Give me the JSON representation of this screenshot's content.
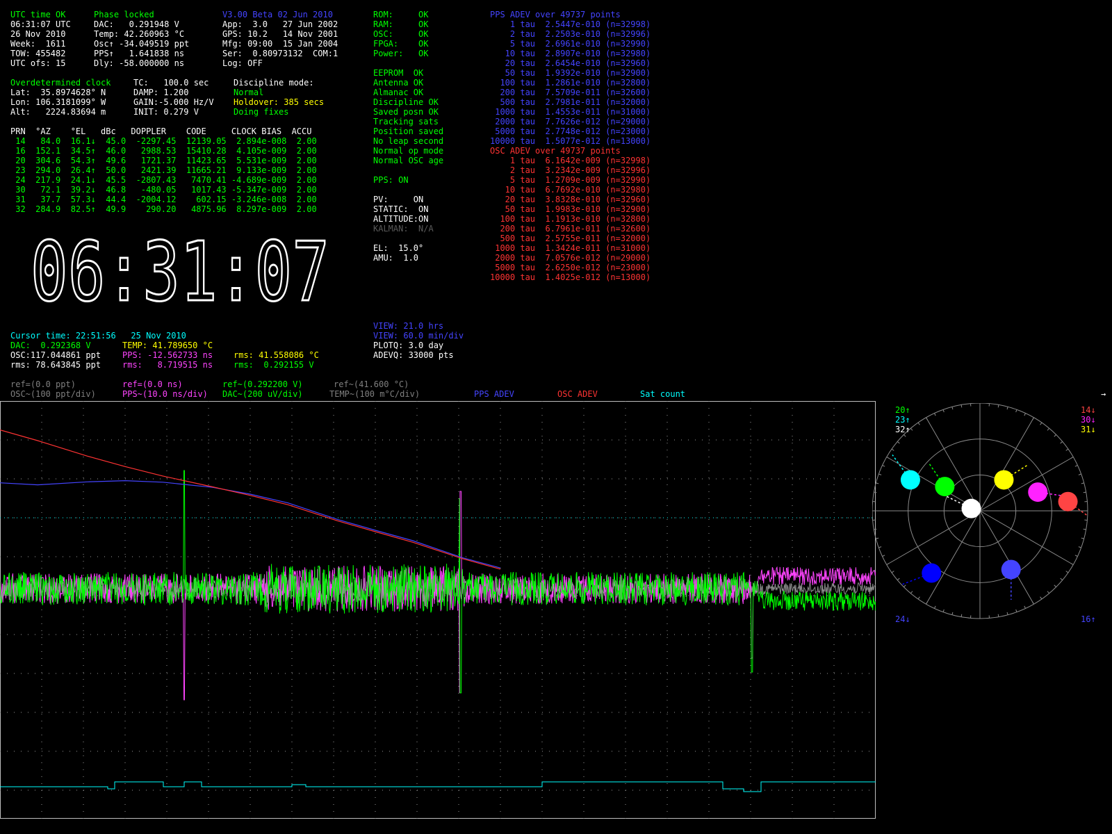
{
  "status_block": {
    "lines": [
      "UTC time OK",
      "06:31:07 UTC",
      "26 Nov 2010",
      "Week:  1611",
      "TOW: 455482",
      "UTC ofs: 15"
    ]
  },
  "phase_block": {
    "lines": [
      "Phase locked",
      "DAC:   0.291948 V",
      "Temp: 42.260963 °C",
      "Osc↑ -34.049519 ppt",
      "PPS↑   1.641838 ns",
      "Dly: -58.000000 ns"
    ]
  },
  "version_block": {
    "lines": [
      "V3.00 Beta 02 Jun 2010",
      "App:  3.0   27 Jun 2002",
      "GPS: 10.2   14 Nov 2001",
      "Mfg: 09:00  15 Jan 2004",
      "Ser:  0.80973132  COM:1",
      "Log: OFF"
    ]
  },
  "selftest_block": {
    "lines": [
      "ROM:     OK",
      "RAM:     OK",
      "OSC:     OK",
      "FPGA:    OK",
      "Power:   OK"
    ]
  },
  "position_block": {
    "lines": [
      "Overdetermined clock",
      "Lat:  35.8974628° N",
      "Lon: 106.3181099° W",
      "Alt:   2224.83694 m"
    ]
  },
  "discipline_params": {
    "lines": [
      "TC:   100.0 sec",
      "DAMP: 1.200",
      "GAIN:-5.000 Hz/V",
      "INIT: 0.279 V"
    ]
  },
  "discipline_mode": {
    "title": "Discipline mode:",
    "mode": "Normal",
    "holdover_label": "Holdover:",
    "holdover_value": " 385 secs",
    "fixes": "Doing fixes"
  },
  "receiver_status": {
    "lines": [
      "EEPROM  OK",
      "Antenna OK",
      "Almanac OK",
      "Discipline OK",
      "Saved posn OK",
      "Tracking sats",
      "Position saved",
      "No leap second",
      "Normal op mode",
      "Normal OSC age"
    ]
  },
  "pps_state": "PPS: ON",
  "filters": {
    "lines": [
      "PV:     ON",
      "STATIC:  ON",
      "ALTITUDE:ON"
    ],
    "kalman": "KALMAN:  N/A"
  },
  "mask": {
    "lines": [
      "EL:  15.0°",
      "AMU:  1.0"
    ]
  },
  "sat_table": {
    "header": "PRN  °AZ    °EL   dBc   DOPPLER    CODE     CLOCK BIAS  ACCU",
    "rows": [
      " 14   84.0  16.1↓  45.0  -2297.45  12139.05  2.894e-008  2.00",
      " 16  152.1  34.5↑  46.0   2988.53  15410.28  4.105e-009  2.00",
      " 20  304.6  54.3↑  49.6   1721.37  11423.65  5.531e-009  2.00",
      " 23  294.0  26.4↑  50.0   2421.39  11665.21  9.133e-009  2.00",
      " 24  217.9  24.1↓  45.5  -2807.43   7470.41 -4.689e-009  2.00",
      " 30   72.1  39.2↓  46.8   -480.05   1017.43 -5.347e-009  2.00",
      " 31   37.7  57.3↓  44.4  -2004.12    602.15 -3.246e-008  2.00",
      " 32  284.9  82.5↑  49.9    290.20   4875.96  8.297e-009  2.00"
    ]
  },
  "big_clock": "06:31:07",
  "pps_adev": {
    "title": "PPS ADEV over 49737 points",
    "rows": [
      "    1 tau  2.5447e-010 (n=32998)",
      "    2 tau  2.2503e-010 (n=32996)",
      "    5 tau  2.6961e-010 (n=32990)",
      "   10 tau  2.8907e-010 (n=32980)",
      "   20 tau  2.6454e-010 (n=32960)",
      "   50 tau  1.9392e-010 (n=32900)",
      "  100 tau  1.2861e-010 (n=32800)",
      "  200 tau  7.5709e-011 (n=32600)",
      "  500 tau  2.7981e-011 (n=32000)",
      " 1000 tau  1.4553e-011 (n=31000)",
      " 2000 tau  7.7626e-012 (n=29000)",
      " 5000 tau  2.7748e-012 (n=23000)",
      "10000 tau  1.5077e-012 (n=13000)"
    ]
  },
  "osc_adev": {
    "title": "OSC ADEV over 49737 points",
    "rows": [
      "    1 tau  6.1642e-009 (n=32998)",
      "    2 tau  3.2342e-009 (n=32996)",
      "    5 tau  1.2709e-009 (n=32990)",
      "   10 tau  6.7692e-010 (n=32980)",
      "   20 tau  3.8328e-010 (n=32960)",
      "   50 tau  1.9983e-010 (n=32900)",
      "  100 tau  1.1913e-010 (n=32800)",
      "  200 tau  6.7961e-011 (n=32600)",
      "  500 tau  2.5755e-011 (n=32000)",
      " 1000 tau  1.3424e-011 (n=31000)",
      " 2000 tau  7.0576e-012 (n=29000)",
      " 5000 tau  2.6250e-012 (n=23000)",
      "10000 tau  1.4025e-012 (n=13000)"
    ]
  },
  "cursor": {
    "time": "Cursor time: 22:51:56   25 Nov 2010",
    "dac": "DAC:  0.292368 V",
    "temp": "TEMP: 41.789650 °C",
    "osc": "OSC:117.044861 ppt",
    "pps": "PPS: -12.562733 ns",
    "rms_temp": "rms: 41.558086 °C",
    "rms_osc": "rms: 78.643845 ppt",
    "rms_pps": "rms:   8.719515 ns",
    "rms_dac": "rms:  0.292155 V"
  },
  "view": {
    "hrs": "VIEW: 21.0 hrs",
    "div": "VIEW: 60.0 min/div",
    "plotq": "PLOTQ: 3.0 day",
    "adevq": "ADEVQ: 33000 pts"
  },
  "legend": {
    "osc_ref": "ref=(0.0 ppt)",
    "osc_div": "OSC~(100 ppt/div)",
    "pps_ref": "ref=(0.0 ns)",
    "pps_div": "PPS~(10.0 ns/div)",
    "dac_ref": "ref~(0.292200 V)",
    "dac_div": "DAC~(200 uV/div)",
    "temp_ref": "ref~(41.600 °C)",
    "temp_div": "TEMP~(100 m°C/div)",
    "pps_adev": "PPS ADEV",
    "osc_adev": "OSC ADEV",
    "sat_count": "Sat count"
  },
  "sky": {
    "labels_left": [
      "20↑",
      "23↑",
      "32↑"
    ],
    "labels_right": [
      "14↓",
      "30↓",
      "31↓"
    ],
    "bottom_left": "24↓",
    "bottom_right": "16↑",
    "sats": [
      {
        "prn": 14,
        "az": 84.0,
        "el": 16.1,
        "color": "#ff4444"
      },
      {
        "prn": 16,
        "az": 152.1,
        "el": 34.5,
        "color": "#4444ff"
      },
      {
        "prn": 20,
        "az": 304.6,
        "el": 54.3,
        "color": "#00ff00"
      },
      {
        "prn": 23,
        "az": 294.0,
        "el": 26.4,
        "color": "#00ffff"
      },
      {
        "prn": 24,
        "az": 217.9,
        "el": 24.1,
        "color": "#0000ff"
      },
      {
        "prn": 30,
        "az": 72.1,
        "el": 39.2,
        "color": "#ff22ff"
      },
      {
        "prn": 31,
        "az": 37.7,
        "el": 57.3,
        "color": "#ffff00"
      },
      {
        "prn": 32,
        "az": 284.9,
        "el": 82.5,
        "color": "#ffffff"
      }
    ]
  },
  "colors": {
    "green": "#00ff00",
    "blue": "#4444ff",
    "red": "#ff3333",
    "magenta": "#ff44ff",
    "cyan": "#00ffff",
    "yellow": "#ffff00",
    "gray": "#7f7f7f"
  }
}
